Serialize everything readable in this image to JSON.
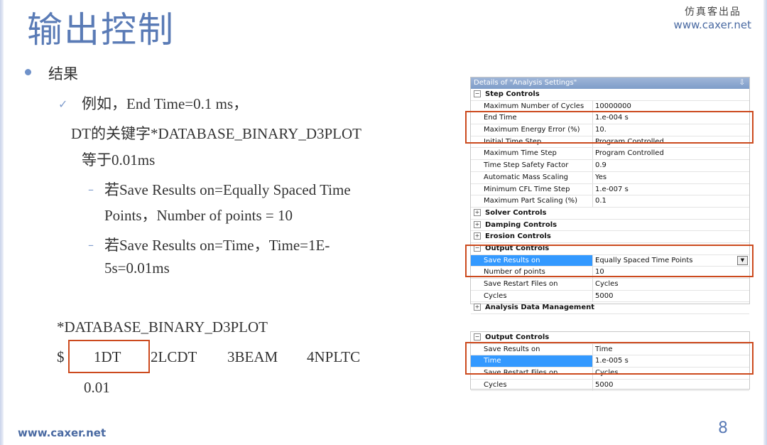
{
  "slide": {
    "title": "输出控制",
    "brand_cn": "仿真客出品",
    "brand_url": "www.caxer.net",
    "footer_url": "www.caxer.net",
    "page_number": "8"
  },
  "content": {
    "bullet_heading": "结果",
    "example_line": "例如，End Time=0.1 ms，",
    "dt_line1": "DT的关键字*DATABASE_BINARY_D3PLOT",
    "dt_line2": "等于0.01ms",
    "case1_line1": "若Save Results on=Equally Spaced Time",
    "case1_line2": "Points，Number of points = 10",
    "case2_line1": "若Save Results on=Time，Time=1E-",
    "case2_line2": "5s=0.01ms",
    "keyword": "*DATABASE_BINARY_D3PLOT",
    "card_dollar": "$",
    "card_fields": [
      "1DT",
      "2LCDT",
      "3BEAM",
      "4NPLTC"
    ],
    "card_value": "0.01"
  },
  "details_panel": {
    "header": "Details of \"Analysis Settings\"",
    "pin": "⇩",
    "step_controls": "Step Controls",
    "rows_step": [
      {
        "label": "Maximum Number of Cycles",
        "value": "10000000"
      },
      {
        "label": "End Time",
        "value": "1.e-004 s"
      },
      {
        "label": "Maximum Energy Error (%)",
        "value": "10."
      },
      {
        "label": "Initial Time Step",
        "value": "Program Controlled"
      },
      {
        "label": "Maximum Time Step",
        "value": "Program Controlled"
      },
      {
        "label": "Time Step Safety Factor",
        "value": "0.9"
      },
      {
        "label": "Automatic Mass Scaling",
        "value": "Yes"
      },
      {
        "label": "Minimum CFL Time Step",
        "value": "1.e-007 s"
      },
      {
        "label": "Maximum Part Scaling (%)",
        "value": "0.1"
      }
    ],
    "solver_controls": "Solver Controls",
    "damping_controls": "Damping Controls",
    "erosion_controls": "Erosion Controls",
    "output_controls": "Output Controls",
    "rows_output": [
      {
        "label": "Save Results on",
        "value": "Equally Spaced Time Points"
      },
      {
        "label": "Number of points",
        "value": "10"
      },
      {
        "label": "Save Restart Files on",
        "value": "Cycles"
      },
      {
        "label": "Cycles",
        "value": "5000"
      }
    ],
    "analysis_data": "Analysis Data Management"
  },
  "output_panel": {
    "output_controls": "Output Controls",
    "rows": [
      {
        "label": "Save Results on",
        "value": "Time"
      },
      {
        "label": "Time",
        "value": "1.e-005 s"
      },
      {
        "label": "Save Restart Files on",
        "value": "Cycles"
      },
      {
        "label": "Cycles",
        "value": "5000"
      }
    ]
  },
  "colors": {
    "accent": "#5a7bb6",
    "highlight": "#cc4a1e",
    "selection": "#3399ff"
  }
}
